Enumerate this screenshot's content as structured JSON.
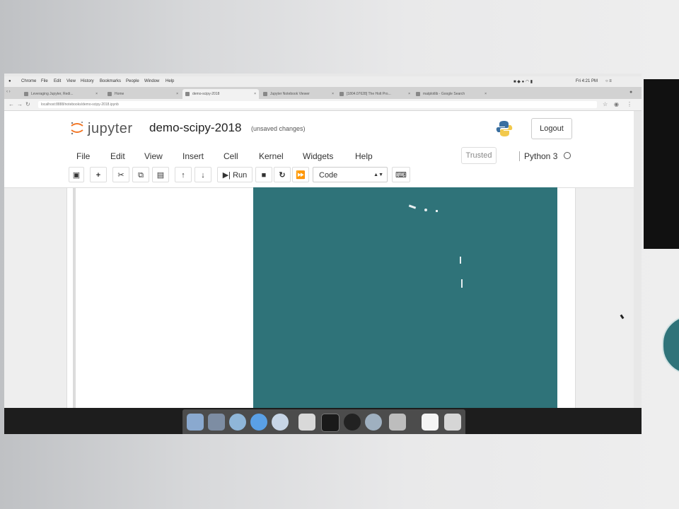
{
  "menubar": {
    "items": [
      "Chrome",
      "File",
      "Edit",
      "View",
      "History",
      "Bookmarks",
      "People",
      "Window",
      "Help"
    ],
    "clock": "Fri 4:21 PM"
  },
  "tabs": [
    {
      "label": "Leveraging Jupyter, Redi..."
    },
    {
      "label": "Home"
    },
    {
      "label": "demo-scipy-2018"
    },
    {
      "label": "Jupyter Notebook Viewer"
    },
    {
      "label": "[1804.07628] The Holt Pro..."
    },
    {
      "label": "matplotlib - Google Search"
    }
  ],
  "address": {
    "url": "localhost:8888/notebooks/demo-scipy-2018.ipynb"
  },
  "jupyter": {
    "logo_text": "jupyter",
    "notebook_title": "demo-scipy-2018",
    "save_status": "(unsaved changes)",
    "logout_label": "Logout",
    "menu": [
      "File",
      "Edit",
      "View",
      "Insert",
      "Cell",
      "Kernel",
      "Widgets",
      "Help"
    ],
    "trusted_label": "Trusted",
    "kernel_label": "Python 3",
    "toolbar": {
      "run_label": "Run",
      "cell_type": "Code",
      "icons": [
        "save-icon",
        "add-cell-icon",
        "cut-icon",
        "copy-icon",
        "paste-icon",
        "move-up-icon",
        "move-down-icon",
        "run-icon",
        "stop-icon",
        "restart-icon",
        "run-all-icon",
        "keyboard-icon"
      ]
    }
  },
  "colors": {
    "output_background": "#2f7379",
    "dock": "#1d1d1d",
    "jupyter_orange": "#f37726"
  },
  "dock_icons": [
    "finder-icon",
    "launchpad-icon",
    "safari-icon",
    "app-store-icon",
    "compass-icon",
    "disk-icon",
    "terminal-icon",
    "spotify-icon",
    "app-icon",
    "sublime-icon",
    "document-icon",
    "trash-icon"
  ]
}
